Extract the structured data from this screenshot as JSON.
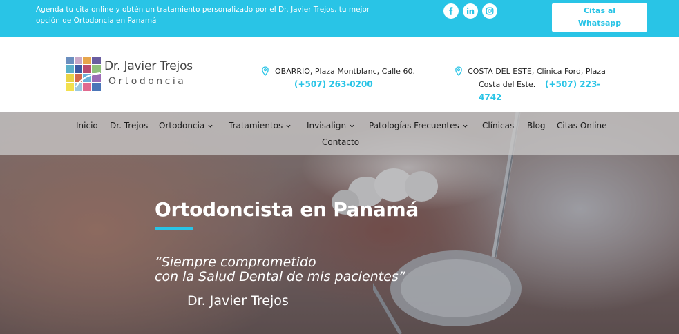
{
  "topbar": {
    "text_line1": "Agenda tu cita online y obtén un tratamiento personalizado por el Dr. Javier Trejos, tu mejor",
    "text_line2": "opción de Ortodoncia en Panamá",
    "socials": [
      "facebook-icon",
      "linkedin-icon",
      "instagram-icon"
    ],
    "whatsapp_line1": "Citas al",
    "whatsapp_line2": "Whatsapp"
  },
  "logo": {
    "name": "Dr. Javier Trejos",
    "subtitle": "Ortodoncia"
  },
  "locations": [
    {
      "address": "OBARRIO, Plaza Montblanc, Calle 60.",
      "phone": "(+507) 263-0200"
    },
    {
      "address_line1": "COSTA DEL ESTE, Clinica Ford, Plaza",
      "address_line2": "Costa del Este.",
      "phone_part1": "(+507) 223-",
      "phone_part2": "4742"
    }
  ],
  "nav": {
    "items": [
      "Inicio",
      "Dr. Trejos",
      "Ortodoncia",
      "Tratamientos",
      "Invisalign",
      "Patologías Frecuentes",
      "Clínicas",
      "Blog",
      "Citas Online",
      "Contacto"
    ]
  },
  "hero": {
    "title": "Ortodoncista en Panamá",
    "quote_line1": "“Siempre comprometido",
    "quote_line2": "con la Salud Dental de mis pacientes”",
    "signature": "Dr. Javier Trejos"
  },
  "colors": {
    "accent": "#29c4e6"
  }
}
